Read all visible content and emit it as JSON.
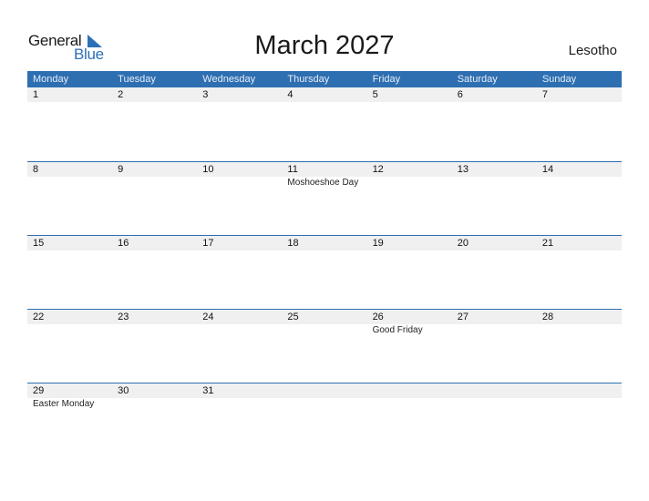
{
  "logo": {
    "line1": "General",
    "line2": "Blue"
  },
  "title": "March 2027",
  "country": "Lesotho",
  "colors": {
    "accent": "#2e6fb2",
    "date_row_bg": "#f0f0f0"
  },
  "weekdays": [
    "Monday",
    "Tuesday",
    "Wednesday",
    "Thursday",
    "Friday",
    "Saturday",
    "Sunday"
  ],
  "weeks": [
    {
      "days": [
        "1",
        "2",
        "3",
        "4",
        "5",
        "6",
        "7"
      ],
      "events": [
        "",
        "",
        "",
        "",
        "",
        "",
        ""
      ]
    },
    {
      "days": [
        "8",
        "9",
        "10",
        "11",
        "12",
        "13",
        "14"
      ],
      "events": [
        "",
        "",
        "",
        "Moshoeshoe Day",
        "",
        "",
        ""
      ]
    },
    {
      "days": [
        "15",
        "16",
        "17",
        "18",
        "19",
        "20",
        "21"
      ],
      "events": [
        "",
        "",
        "",
        "",
        "",
        "",
        ""
      ]
    },
    {
      "days": [
        "22",
        "23",
        "24",
        "25",
        "26",
        "27",
        "28"
      ],
      "events": [
        "",
        "",
        "",
        "",
        "Good Friday",
        "",
        ""
      ]
    },
    {
      "days": [
        "29",
        "30",
        "31",
        "",
        "",
        "",
        ""
      ],
      "events": [
        "Easter Monday",
        "",
        "",
        "",
        "",
        "",
        ""
      ]
    }
  ]
}
